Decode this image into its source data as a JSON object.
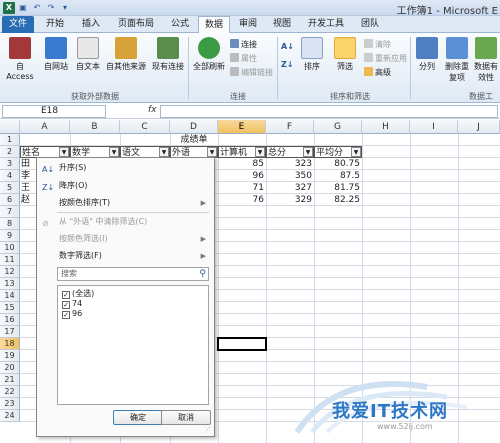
{
  "window": {
    "title": "工作簿1 - Microsoft E"
  },
  "tabs": [
    {
      "label": "文件"
    },
    {
      "label": "开始"
    },
    {
      "label": "插入"
    },
    {
      "label": "页面布局"
    },
    {
      "label": "公式"
    },
    {
      "label": "数据"
    },
    {
      "label": "审阅"
    },
    {
      "label": "视图"
    },
    {
      "label": "开发工具"
    },
    {
      "label": "团队"
    }
  ],
  "ribbon": {
    "get_external": {
      "label": "获取外部数据",
      "buttons": [
        "自 Access",
        "自网站",
        "自文本",
        "自其他来源",
        "现有连接"
      ]
    },
    "connections": {
      "label": "连接",
      "refresh_all": "全部刷新",
      "items": [
        "连接",
        "属性",
        "编辑链接"
      ]
    },
    "sort_filter": {
      "label": "排序和筛选",
      "sort": "排序",
      "filter": "筛选",
      "items": [
        "清除",
        "重新应用",
        "高级"
      ]
    },
    "data_tools": {
      "label": "数据工",
      "buttons": [
        "分列",
        "删除重复项",
        "数据有效性"
      ]
    }
  },
  "formula_bar": {
    "name_box": "E18",
    "fx": "fx",
    "value": ""
  },
  "columns": [
    "A",
    "B",
    "C",
    "D",
    "E",
    "F",
    "G",
    "H",
    "I",
    "J"
  ],
  "rows": [
    "1",
    "2",
    "3",
    "4",
    "5",
    "6",
    "7",
    "8",
    "9",
    "10",
    "11",
    "12",
    "13",
    "14",
    "15",
    "16",
    "17",
    "18",
    "19",
    "20",
    "21",
    "22",
    "23",
    "24"
  ],
  "sheet": {
    "title": "成绩单",
    "headers": [
      "姓名",
      "数学",
      "语文",
      "外语",
      "计算机",
      "总分",
      "平均分"
    ],
    "row_names": [
      "田",
      "李",
      "王",
      "赵"
    ],
    "computer": [
      "85",
      "96",
      "71",
      "76"
    ],
    "total": [
      "323",
      "350",
      "327",
      "329"
    ],
    "average": [
      "80.75",
      "87.5",
      "81.75",
      "82.25"
    ]
  },
  "filter_menu": {
    "sort_asc": "升序(S)",
    "sort_desc": "降序(O)",
    "sort_by_color": "按颜色排序(T)",
    "clear_filter": "从 \"外语\" 中清除筛选(C)",
    "filter_by_color": "按颜色筛选(I)",
    "number_filters": "数字筛选(F)",
    "search_placeholder": "搜索",
    "values": [
      "(全选)",
      "74",
      "96"
    ],
    "ok": "确定",
    "cancel": "取消"
  },
  "watermark": {
    "text": "我爱IT技术网",
    "sub": "www.52ij.com"
  },
  "colors": {
    "accent": "#2a6cb5",
    "selected_header": "#f1c15f",
    "filter_active": "#fbd46b"
  }
}
